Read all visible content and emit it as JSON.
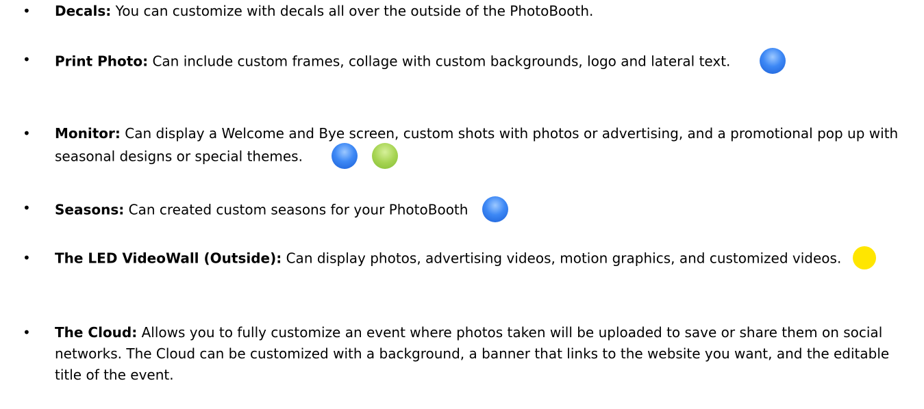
{
  "bullet_char": "•",
  "colors": {
    "blue_dot": "#3d88f5",
    "green_dot": "#a6d452",
    "yellow_dot": "#ffe600"
  },
  "items": [
    {
      "term": "Decals:",
      "text": "You can customize with decals all over the outside of the PhotoBooth.",
      "dots": []
    },
    {
      "term": "Print Photo:",
      "text": "Can include custom frames, collage with custom backgrounds, logo and lateral text.",
      "dots": [
        "blue"
      ]
    },
    {
      "term": "Monitor:",
      "text": "Can display a Welcome and Bye screen, custom shots with photos or advertising, and a promotional pop up with seasonal designs or special themes.",
      "dots": [
        "blue",
        "green"
      ]
    },
    {
      "term": "Seasons:",
      "text": "Can created custom seasons for your PhotoBooth",
      "dots": [
        "blue"
      ]
    },
    {
      "term": "The LED VideoWall (Outside):",
      "text": "Can display photos, advertising videos, motion graphics, and customized videos.",
      "dots": [
        "yellow"
      ]
    },
    {
      "term": "The Cloud:",
      "text": "Allows you to fully customize an event where photos taken will be uploaded to save or share them on social networks. The Cloud can be customized with a background, a banner that links to the website you want, and the editable title of the event.",
      "dots": []
    }
  ]
}
